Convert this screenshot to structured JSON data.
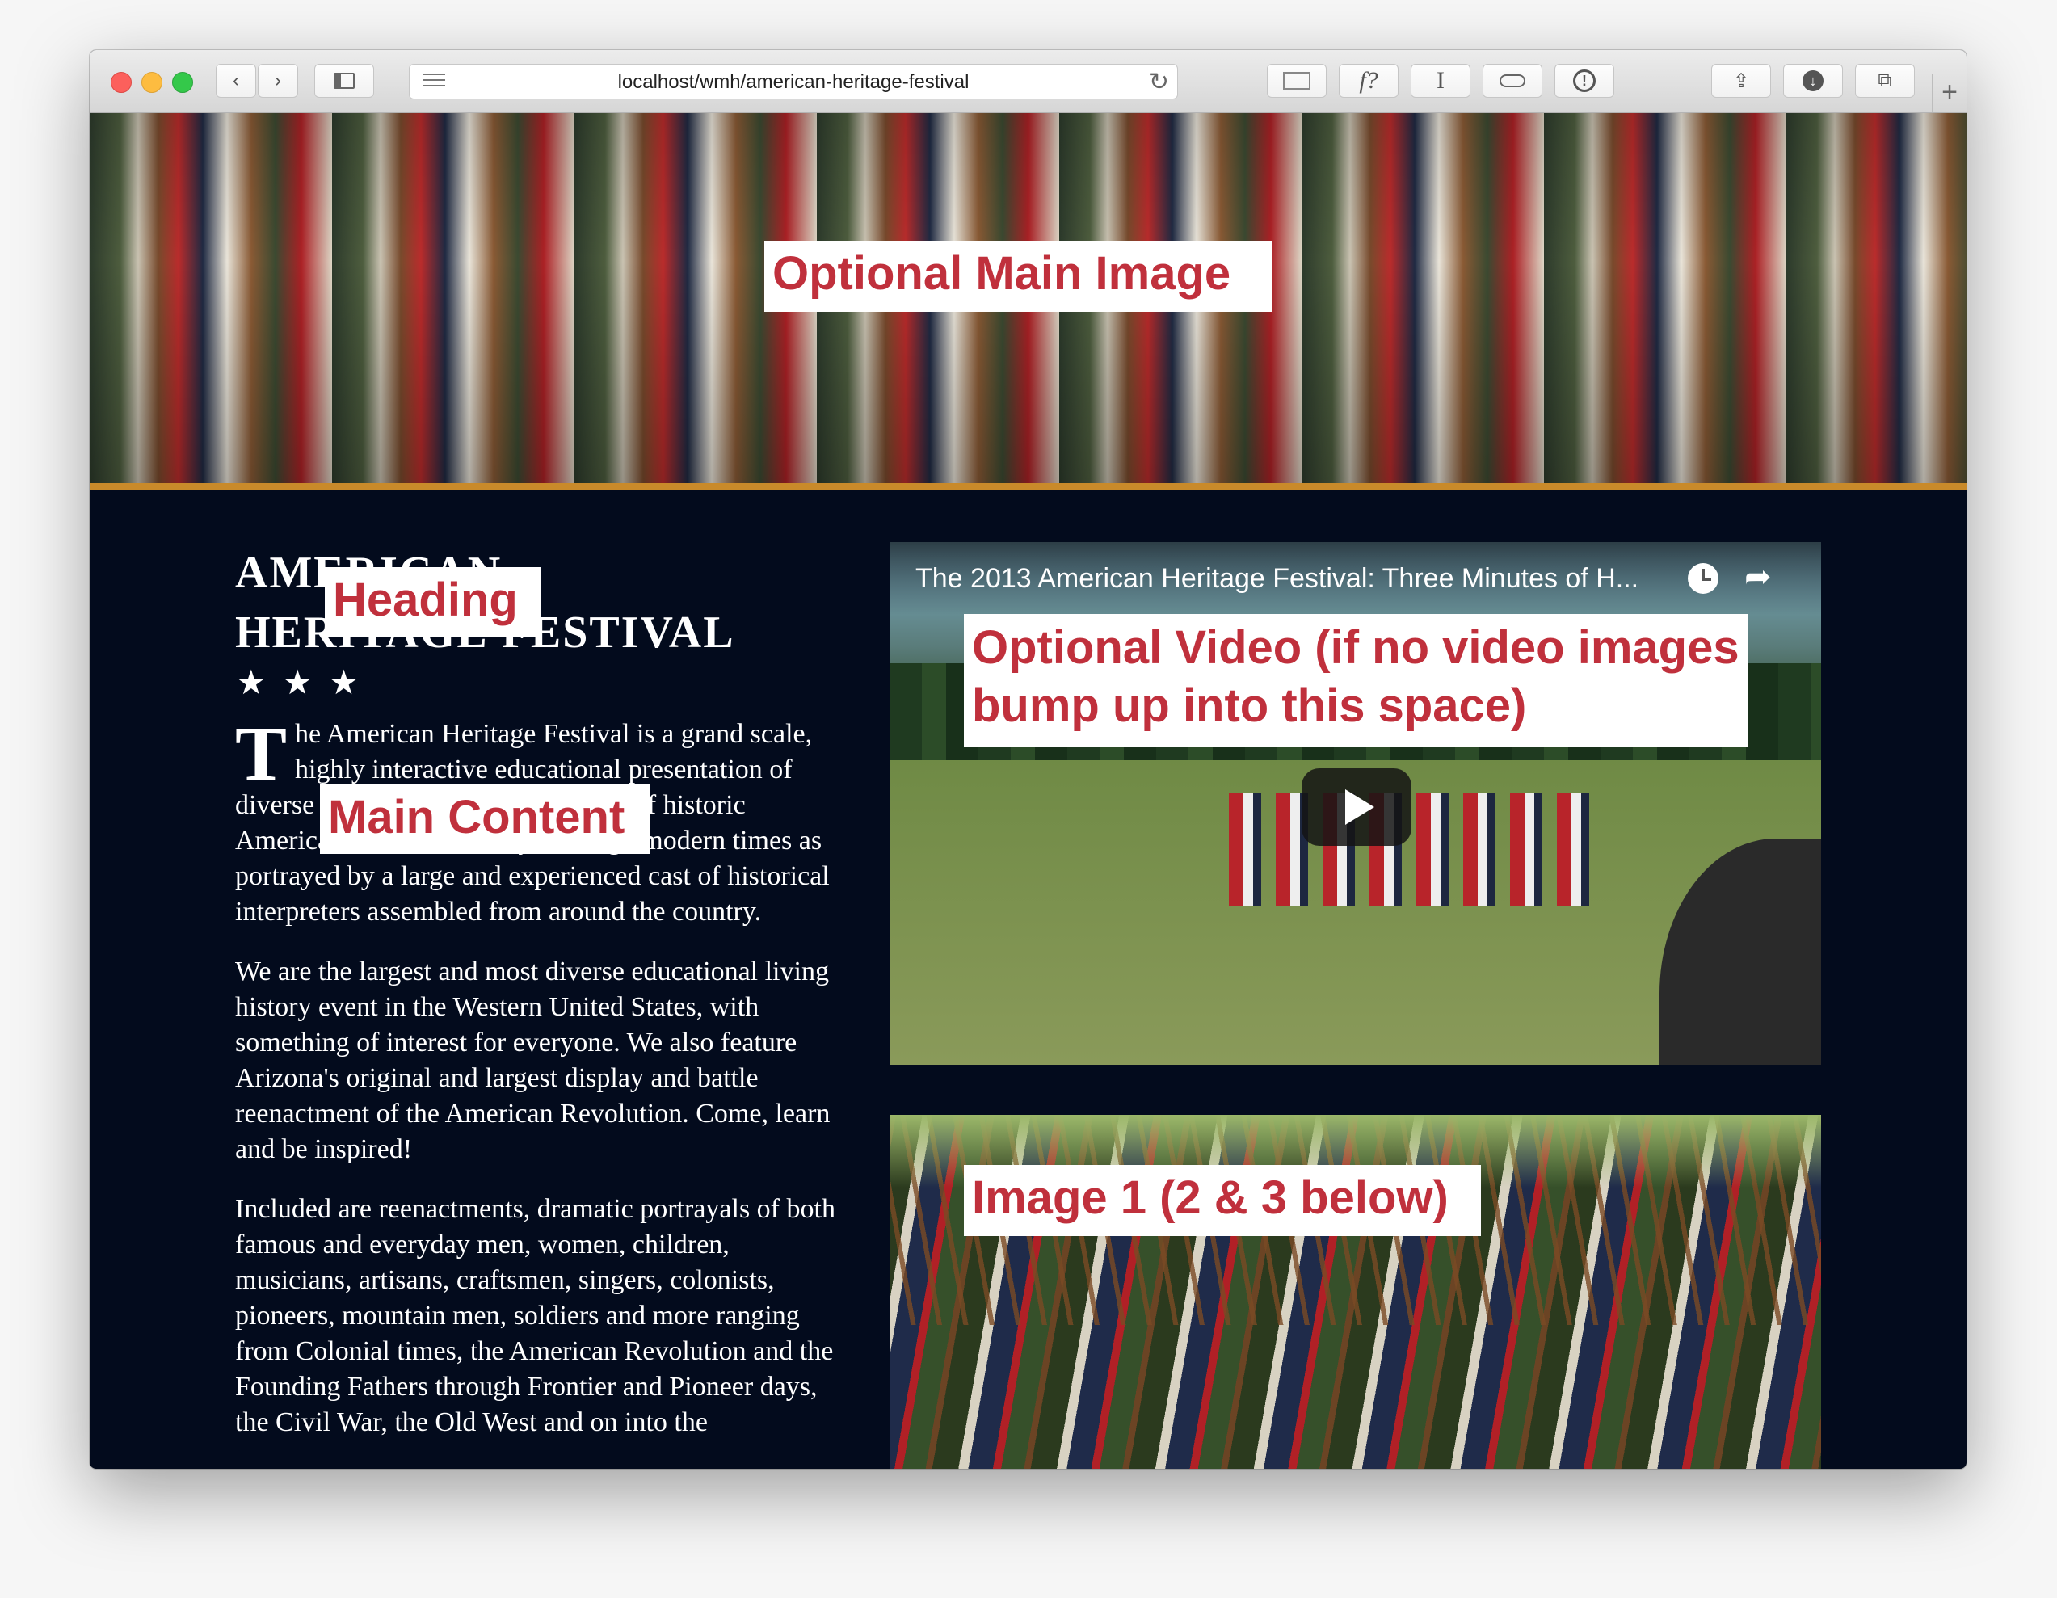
{
  "browser": {
    "url": "localhost/wmh/american-heritage-festival",
    "toolbar_icons": [
      "back-icon",
      "forward-icon",
      "sidebar-icon",
      "reader-icon",
      "reload-icon",
      "share-icon",
      "download-icon",
      "tabs-icon",
      "new-tab-icon"
    ]
  },
  "hero": {
    "callout": "Optional Main Image"
  },
  "content": {
    "heading": "AMERICAN HERITAGE FESTIVAL",
    "heading_callout": "Heading",
    "stars": "★ ★ ★",
    "main_callout": "Main Content",
    "dropcap": "T",
    "paragraph1_rest": "he American Heritage Festival is a grand scale, highly interactive educational presentation of diverse aspects of the many periods of historic America from colonial days through modern times as portrayed by a large and experienced cast of historical interpreters assembled from around the country.",
    "paragraph2": "We are the largest and most diverse educational living history event in the Western United States, with something of interest for everyone. We also feature Arizona's original and largest display and battle reenactment of the American Revolution. Come, learn and be inspired!",
    "paragraph3": "Included are reenactments, dramatic portrayals of both famous and everyday men, women, children, musicians, artisans, craftsmen, singers, colonists, pioneers, mountain men, soldiers and more ranging from Colonial times, the American Revolution and the Founding Fathers through Frontier and Pioneer days, the Civil War, the Old West and on into the"
  },
  "video": {
    "title": "The 2013 American Heritage Festival: Three Minutes of H...",
    "callout": "Optional Video (if no video images bump up into this space)"
  },
  "image1": {
    "callout": "Image 1 (2 & 3 below)"
  },
  "colors": {
    "page_bg": "#030b1d",
    "accent_rule": "#c98a2a",
    "callout_text": "#c0303c"
  }
}
